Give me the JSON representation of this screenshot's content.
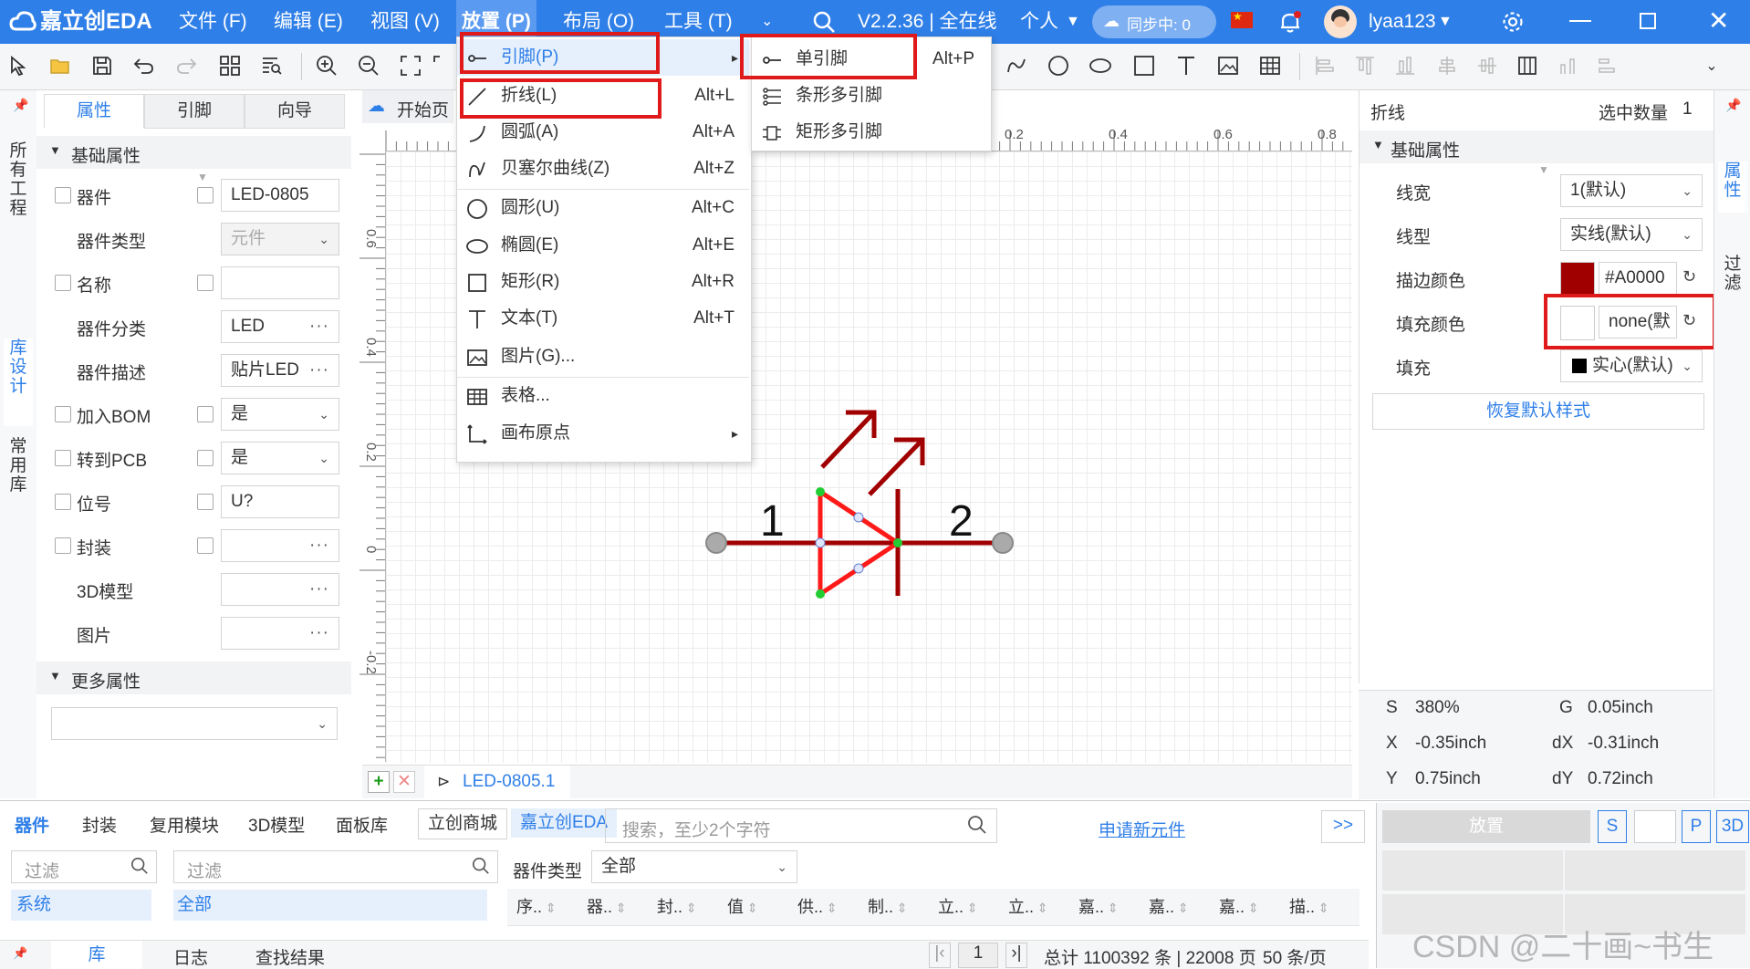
{
  "app": {
    "logo_text": "嘉立创EDA",
    "version": "V2.2.36 | 全在线",
    "edition": "个人",
    "sync_label": "同步中: 0",
    "user": "lyaa123"
  },
  "menubar": {
    "file": "文件 (F)",
    "edit": "编辑 (E)",
    "view": "视图 (V)",
    "place": "放置 (P)",
    "layout": "布局 (O)",
    "tools": "工具 (T)"
  },
  "left_panel": {
    "tabs": [
      "属性",
      "引脚",
      "向导"
    ],
    "side_tabs": [
      "所有工程",
      "库设计",
      "常用库"
    ],
    "section_basic": "基础属性",
    "section_more": "更多属性",
    "rows": [
      {
        "label": "器件",
        "value": "LED-0805"
      },
      {
        "label": "器件类型",
        "value": "元件"
      },
      {
        "label": "名称",
        "value": ""
      },
      {
        "label": "器件分类",
        "value": "LED"
      },
      {
        "label": "器件描述",
        "value": "贴片LED"
      },
      {
        "label": "加入BOM",
        "value": "是"
      },
      {
        "label": "转到PCB",
        "value": "是"
      },
      {
        "label": "位号",
        "value": "U?"
      },
      {
        "label": "封装",
        "value": ""
      },
      {
        "label": "3D模型",
        "value": ""
      },
      {
        "label": "图片",
        "value": ""
      }
    ]
  },
  "doc_tabs": {
    "start": "开始页",
    "current": "LED-0805.1"
  },
  "place_menu": {
    "items": [
      {
        "label": "引脚(P)",
        "shortcut": "",
        "icon": "pin-icon"
      },
      {
        "label": "折线(L)",
        "shortcut": "Alt+L",
        "icon": "polyline-icon"
      },
      {
        "label": "圆弧(A)",
        "shortcut": "Alt+A",
        "icon": "arc-icon"
      },
      {
        "label": "贝塞尔曲线(Z)",
        "shortcut": "Alt+Z",
        "icon": "bezier-icon"
      },
      {
        "label": "圆形(U)",
        "shortcut": "Alt+C",
        "icon": "circle-icon"
      },
      {
        "label": "椭圆(E)",
        "shortcut": "Alt+E",
        "icon": "ellipse-icon"
      },
      {
        "label": "矩形(R)",
        "shortcut": "Alt+R",
        "icon": "rectangle-icon"
      },
      {
        "label": "文本(T)",
        "shortcut": "Alt+T",
        "icon": "text-icon"
      },
      {
        "label": "图片(G)...",
        "shortcut": "",
        "icon": "image-icon"
      },
      {
        "label": "表格...",
        "shortcut": "",
        "icon": "table-icon"
      },
      {
        "label": "画布原点",
        "shortcut": "",
        "icon": "origin-icon"
      }
    ],
    "submenu": [
      {
        "label": "单引脚",
        "shortcut": "Alt+P"
      },
      {
        "label": "条形多引脚",
        "shortcut": ""
      },
      {
        "label": "矩形多引脚",
        "shortcut": ""
      }
    ]
  },
  "ruler": {
    "top": [
      "0.2",
      "0.4",
      "0.6",
      "0.8"
    ],
    "left": [
      "0.6",
      "0.4",
      "0.2",
      "0",
      "-0.2"
    ]
  },
  "symbol": {
    "pin1": "1",
    "pin2": "2"
  },
  "right_panel": {
    "title": "折线",
    "selected_label": "选中数量",
    "selected_count": "1",
    "section": "基础属性",
    "side_tabs": [
      "属性",
      "过滤"
    ],
    "line_width_label": "线宽",
    "line_width": "1(默认)",
    "line_type_label": "线型",
    "line_type": "实线(默认)",
    "stroke_color_label": "描边颜色",
    "stroke_color": "#A0000",
    "fill_color_label": "填充颜色",
    "fill_color": "none(默",
    "fill_label": "填充",
    "fill": "实心(默认)",
    "reset": "恢复默认样式",
    "colors": {
      "stroke_swatch": "#a00000",
      "fill_swatch": "#ffffff",
      "fill_solid": "#000000"
    },
    "status": {
      "s_label": "S",
      "s": "380%",
      "g_label": "G",
      "g": "0.05inch",
      "x_label": "X",
      "x": "-0.35inch",
      "dx_label": "dX",
      "dx": "-0.31inch",
      "y_label": "Y",
      "y": "0.75inch",
      "dy_label": "dY",
      "dy": "0.72inch"
    }
  },
  "bottom_panel": {
    "tabs": [
      "器件",
      "封装",
      "复用模块",
      "3D模型",
      "面板库",
      "立创商城",
      "嘉立创EDA"
    ],
    "search_placeholder": "搜索，至少2个字符",
    "apply_link": "申请新元件",
    "expand": ">>",
    "filter1_placeholder": "过滤",
    "filter2_placeholder": "过滤",
    "tree_system": "系统",
    "tree_all": "全部",
    "type_label": "器件类型",
    "type_value": "全部",
    "columns": [
      "序..",
      "器..",
      "封..",
      "值",
      "供..",
      "制..",
      "立..",
      "立..",
      "嘉..",
      "嘉..",
      "嘉..",
      "描.."
    ],
    "bottom_tabs": [
      "库",
      "日志",
      "查找结果"
    ],
    "page": "1",
    "total": "总计 1100392 条 | 22008 页",
    "per_page": "50 条/页"
  },
  "place_panel": {
    "place_button": "放置",
    "s": "S",
    "p": "P",
    "d3": "3D"
  },
  "watermark": "CSDN @二十画~书生"
}
